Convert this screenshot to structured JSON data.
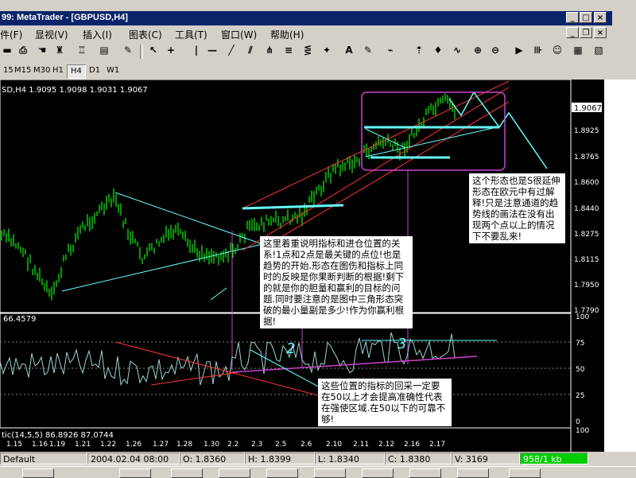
{
  "window": {
    "title": "99: MetaTrader - [GBPUSD,H4]",
    "btn_min": "_",
    "btn_max": "□",
    "btn_close": "×",
    "child_min": "_",
    "child_restore": "❐",
    "child_close": "×"
  },
  "menu": [
    "件(F)",
    "显视(V)",
    "插入(I)",
    "图表(C)",
    "工具(T)",
    "窗口(W)",
    "帮助(H)"
  ],
  "toolbar_icons": [
    "save-icon",
    "print-icon",
    "hand-icon",
    "tower-icon",
    "tower2-icon",
    "properties-icon",
    "pencil-icon",
    "cursor-icon",
    "crosshair-icon",
    "vline-icon",
    "hline-icon",
    "trendline-icon",
    "channel-icon",
    "fibo-icon",
    "gann-icon",
    "fibo-fan-icon",
    "text-icon",
    "label-icon",
    "period-icon",
    "arrow-up-icon",
    "arrow-down-icon",
    "zoom-in-icon",
    "zoom-out-icon",
    "chart-shift-icon",
    "autoscroll-icon",
    "expert-icon",
    "bar-chart-icon",
    "candle-icon"
  ],
  "timeframes": [
    {
      "label": "15",
      "active": false
    },
    {
      "label": "M15",
      "active": false
    },
    {
      "label": "M30",
      "active": false
    },
    {
      "label": "H1",
      "active": false
    },
    {
      "label": "H4",
      "active": true
    },
    {
      "label": "D1",
      "active": false
    },
    {
      "label": "W1",
      "active": false
    }
  ],
  "chart": {
    "header": "SD,H4 1.9095 1.9098 1.9031 1.9067",
    "price_labels": [
      "1.9067",
      "1.8925",
      "1.8765",
      "1.8600",
      "1.8440",
      "1.8275",
      "1.8115",
      "1.7950",
      "1.7790"
    ],
    "current_price": "1.9067",
    "indicator_header": "66.4579",
    "indicator_levels": [
      "100",
      "75",
      "50",
      "25",
      "0"
    ],
    "stoch_header": "tic(14,5,5)  86.8926  87.0744",
    "stoch_level": "100",
    "date_labels": [
      "1.15",
      "1.16",
      "1.19",
      "1.21",
      "1.22",
      "1.26",
      "1.27",
      "1.28",
      "1.30",
      "2.2",
      "2.3",
      "2.5",
      "2.6",
      "2.10",
      "2.11",
      "2.12",
      "2.16",
      "2.17"
    ],
    "marker_2": "2",
    "marker_3": "3",
    "note1": "这里着重说明指标和进仓位置的关系!1点和2点是最关键的点位!也是趋势的开始.形态在图伤和指标上同时的反映是你果断判断的根据!剩下的就是你的胆量和赢利的目标的问题.同时要注意的是图中三角形态突破的最小量副是多少!作为你赢利根据!",
    "note2": "这个形态也是S很延伸形态在欧元中有过解释!只是注意通道的趋势线的画法在没有出现两个点以上的情况下不要乱来!",
    "note3": "这些位置的指标的回采一定要在50以上才会提高准确性代表在强使区域.在50以下的可靠不够!"
  },
  "status": {
    "profile": "Default",
    "datetime": "2004.02.04 08:00",
    "open": "O: 1.8360",
    "high": "H: 1.8399",
    "low": "L: 1.8340",
    "close": "C: 1.8380",
    "volume": "V: 3169",
    "traffic": "958/1 kb"
  },
  "colors": {
    "candle": "#00ff00",
    "channel": "#ff0000",
    "cyan_lines": "#66ffff",
    "magenta_box": "#cc44cc",
    "indicator_line": "#9ad6d6"
  }
}
